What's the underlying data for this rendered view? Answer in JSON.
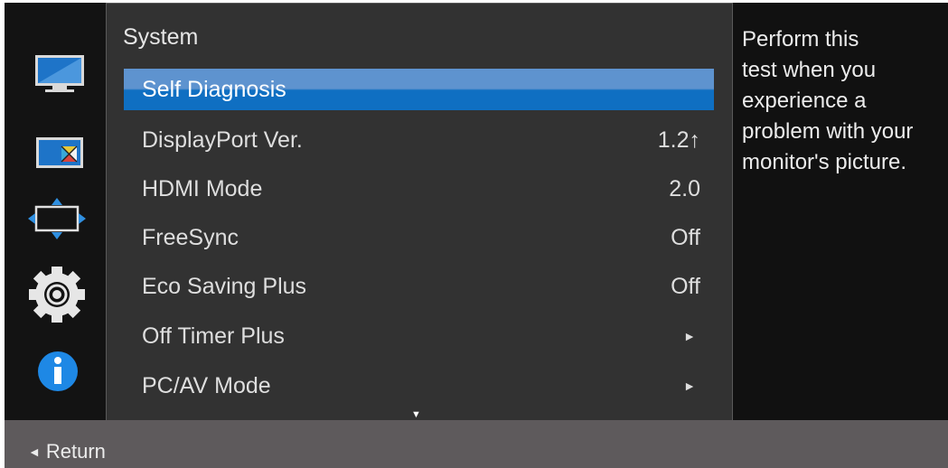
{
  "sidebar": {
    "icons": [
      {
        "name": "picture-icon"
      },
      {
        "name": "color-icon"
      },
      {
        "name": "size-position-icon"
      },
      {
        "name": "gear-icon"
      },
      {
        "name": "info-icon"
      }
    ],
    "active_index": 3
  },
  "menu": {
    "title": "System",
    "items": [
      {
        "label": "Self Diagnosis",
        "value": "",
        "selected": true
      },
      {
        "label": "DisplayPort Ver.",
        "value": "1.2↑"
      },
      {
        "label": "HDMI Mode",
        "value": "2.0"
      },
      {
        "label": "FreeSync",
        "value": "Off"
      },
      {
        "label": "Eco Saving Plus",
        "value": "Off"
      },
      {
        "label": "Off Timer Plus",
        "value": "►"
      },
      {
        "label": "PC/AV Mode",
        "value": "►"
      }
    ],
    "scroll_indicator": "▼"
  },
  "help": {
    "text": "Perform this\ntest when you\nexperience a\nproblem with your\nmonitor's picture."
  },
  "footer": {
    "return_icon": "◄",
    "return_label": "Return"
  },
  "colors": {
    "selected_top": "#5e93cf",
    "selected_bottom": "#0f6fc2",
    "panel_bg": "#323232",
    "footer_bg": "#5e5a5c"
  }
}
